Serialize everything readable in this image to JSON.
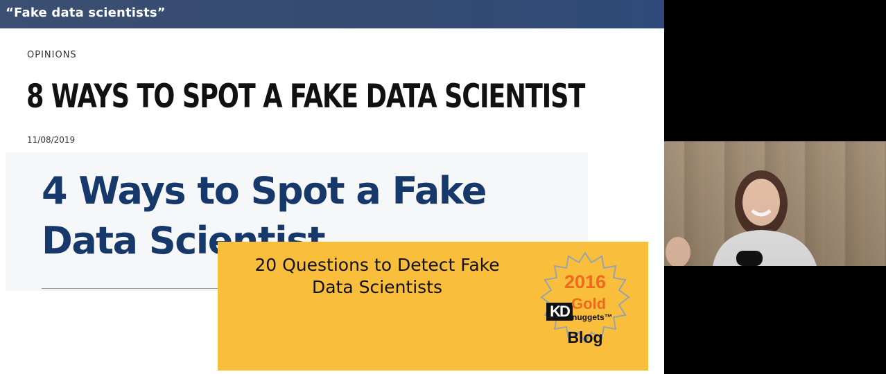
{
  "slide": {
    "title": "“Fake data scientists”",
    "category": "OPINIONS",
    "headline": "8 WAYS TO SPOT A FAKE DATA SCIENTIST",
    "date": "11/08/2019",
    "article_title": "4 Ways to Spot a Fake Data Scientist"
  },
  "card": {
    "title": "20 Questions to Detect Fake Data Scientists",
    "badge": {
      "year": "2016",
      "gold": "Gold",
      "kd": "KD",
      "nuggets": "nuggets™",
      "blog": "Blog"
    }
  },
  "colors": {
    "titlebar": "#344a70",
    "article_title": "#16386b",
    "card_bg": "#f9bf3c",
    "badge_accent": "#f06a1c"
  },
  "icons": [
    "webcam-feed",
    "award-badge"
  ]
}
